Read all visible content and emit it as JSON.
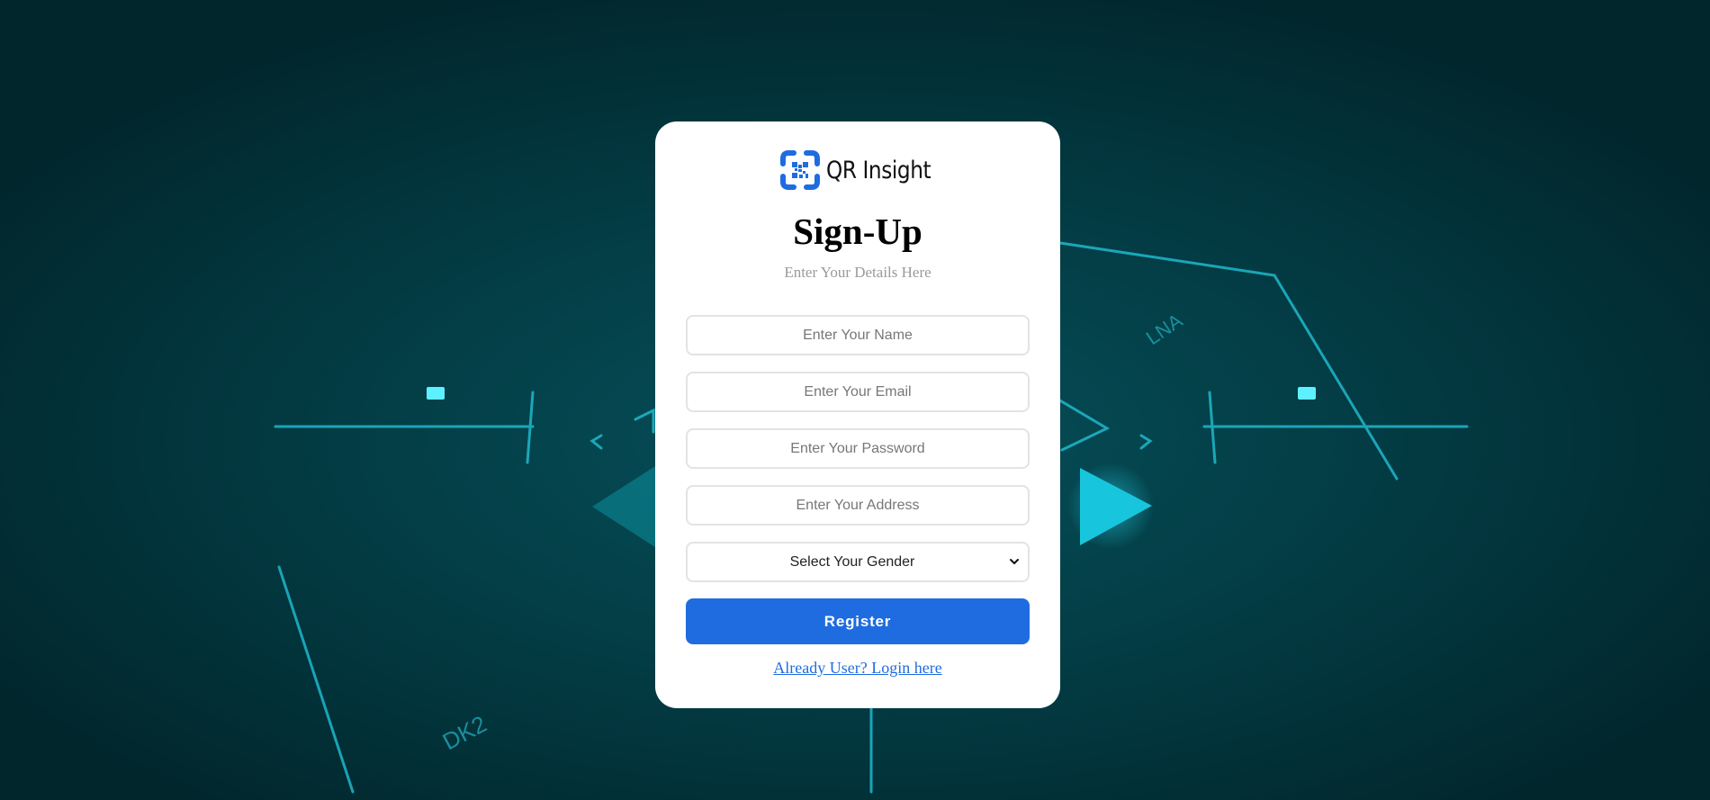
{
  "brand": {
    "name": "QR Insight",
    "logo_icon": "qr-scan-icon",
    "accent_color": "#1f6ce0"
  },
  "form": {
    "title": "Sign-Up",
    "subtitle": "Enter Your Details Here",
    "name_placeholder": "Enter Your Name",
    "email_placeholder": "Enter Your Email",
    "password_placeholder": "Enter Your Password",
    "address_placeholder": "Enter Your Address",
    "gender_selected": "Select Your Gender",
    "register_label": "Register",
    "login_link": "Already User? Login here"
  },
  "background": {
    "labels": [
      "LNA",
      "DK2"
    ],
    "glow_color": "#17c6dc"
  }
}
